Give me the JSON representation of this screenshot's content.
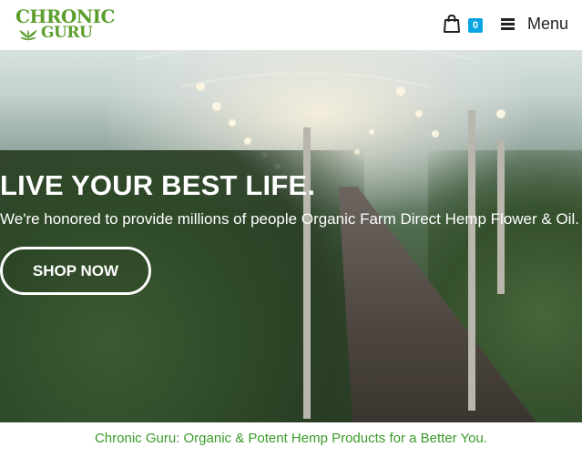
{
  "header": {
    "logo_line1": "CHRONIC",
    "logo_line2": "GURU",
    "cart_count": "0",
    "menu_label": "Menu",
    "brand_color": "#5c9e2e",
    "badge_color": "#0aa5e3"
  },
  "hero": {
    "title": "LIVE YOUR BEST LIFE.",
    "subtitle": "We're honored to provide millions of people Organic Farm Direct Hemp Flower & Oil.",
    "cta_label": "SHOP NOW",
    "background": "greenhouse-cannabis-photo"
  },
  "footer": {
    "tagline": "Chronic Guru: Organic & Potent Hemp Products for a Better You.",
    "tagline_color": "#3a9a2a"
  },
  "icons": {
    "cart": "shopping-bag-icon",
    "menu": "hamburger-icon",
    "logo_leaf": "cannabis-leaf-icon"
  }
}
